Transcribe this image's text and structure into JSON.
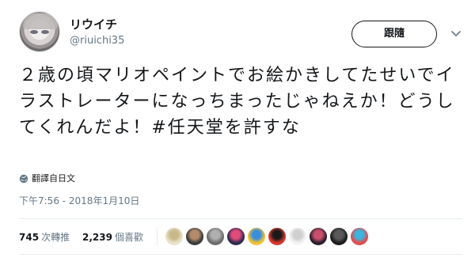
{
  "user": {
    "display_name": "リウイチ",
    "handle": "@riuichi35",
    "avatar_icon": "user-avatar-icon"
  },
  "actions": {
    "follow_label": "跟隨",
    "menu_icon": "chevron-down-icon"
  },
  "tweet": {
    "text": "２歳の頃マリオペイントでお絵かきしてたせいでイラストレーターになっちまったじゃねえか！どうしてくれんだよ！#任天堂を許すな",
    "translate_label": "翻譯自日文",
    "translate_icon": "globe-icon",
    "timestamp": "下午7:56 - 2018年1月10日"
  },
  "stats": {
    "retweets_count": "745",
    "retweets_label": "次轉推",
    "likes_count": "2,239",
    "likes_label": "個喜歡"
  },
  "likers": [
    {
      "name": "liker-avatar-1",
      "color": "#e9e2c9",
      "accent": "#c9b98a"
    },
    {
      "name": "liker-avatar-2",
      "color": "#3b3b3b",
      "accent": "#b58c6a"
    },
    {
      "name": "liker-avatar-3",
      "color": "#6b6b6b",
      "accent": "#b0b0b0"
    },
    {
      "name": "liker-avatar-4",
      "color": "#2e2a4f",
      "accent": "#e04b7a"
    },
    {
      "name": "liker-avatar-5",
      "color": "#f2c230",
      "accent": "#3a8ee0"
    },
    {
      "name": "liker-avatar-6",
      "color": "#d9372f",
      "accent": "#1a1a1a"
    },
    {
      "name": "liker-avatar-7",
      "color": "#f4f4f4",
      "accent": "#cfcfcf"
    },
    {
      "name": "liker-avatar-8",
      "color": "#2a1f2d",
      "accent": "#c94f6b"
    },
    {
      "name": "liker-avatar-9",
      "color": "#1c1c1c",
      "accent": "#5a5a5a"
    },
    {
      "name": "liker-avatar-10",
      "color": "#e54b4b",
      "accent": "#3bb4e0"
    }
  ]
}
